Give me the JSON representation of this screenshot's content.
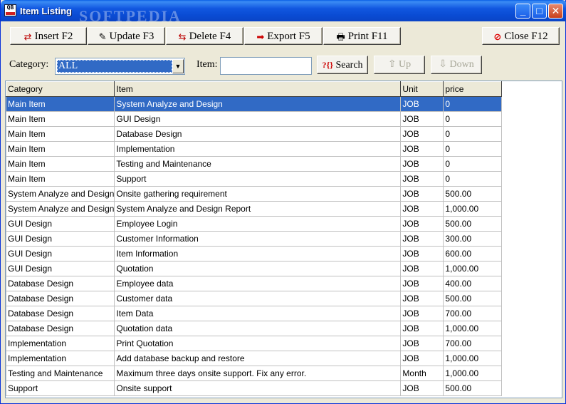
{
  "window": {
    "title": "Item Listing",
    "icon_text": "QB",
    "watermark": "SOFTPEDIA",
    "controls": {
      "minimize": "_",
      "maximize": "□",
      "close": "✕"
    }
  },
  "toolbar": {
    "insert": "Insert F2",
    "update": "Update F3",
    "delete": "Delete F4",
    "export": "Export F5",
    "print": "Print F11",
    "close": "Close F12"
  },
  "filter": {
    "category_label": "Category:",
    "category_value": "ALL",
    "item_label": "Item:",
    "item_value": "",
    "search": "Search",
    "up": "Up",
    "down": "Down"
  },
  "colors": {
    "selection": "#316ac5",
    "titlebar": "#0a4cd4",
    "face": "#ece9d8"
  },
  "table": {
    "columns": [
      "Category",
      "Item",
      "Unit",
      "price"
    ],
    "selected_row": 0,
    "rows": [
      [
        "Main Item",
        "System  Analyze and Design",
        "JOB",
        "0"
      ],
      [
        "Main Item",
        "GUI Design",
        "JOB",
        "0"
      ],
      [
        "Main Item",
        "Database Design",
        "JOB",
        "0"
      ],
      [
        "Main Item",
        "Implementation",
        "JOB",
        "0"
      ],
      [
        "Main Item",
        "Testing and Maintenance",
        "JOB",
        "0"
      ],
      [
        "Main Item",
        "Support",
        "JOB",
        "0"
      ],
      [
        "System  Analyze and Design",
        "Onsite gathering requirement",
        "JOB",
        "500.00"
      ],
      [
        "System  Analyze and Design",
        "System  Analyze and Design Report",
        "JOB",
        "1,000.00"
      ],
      [
        "GUI Design",
        "Employee Login",
        "JOB",
        "500.00"
      ],
      [
        "GUI Design",
        "Customer Information",
        "JOB",
        "300.00"
      ],
      [
        "GUI Design",
        "Item Information",
        "JOB",
        "600.00"
      ],
      [
        "GUI Design",
        "Quotation",
        "JOB",
        "1,000.00"
      ],
      [
        "Database Design",
        "Employee data",
        "JOB",
        "400.00"
      ],
      [
        "Database Design",
        "Customer data",
        "JOB",
        "500.00"
      ],
      [
        "Database Design",
        "Item Data",
        "JOB",
        "700.00"
      ],
      [
        "Database Design",
        "Quotation data",
        "JOB",
        "1,000.00"
      ],
      [
        "Implementation",
        "Print Quotation",
        "JOB",
        "700.00"
      ],
      [
        "Implementation",
        "Add database backup and restore",
        "JOB",
        "1,000.00"
      ],
      [
        "Testing and Maintenance",
        "Maximum three days onsite support. Fix any error.",
        "Month",
        "1,000.00"
      ],
      [
        "Support",
        "Onsite support",
        "JOB",
        "500.00"
      ]
    ]
  }
}
